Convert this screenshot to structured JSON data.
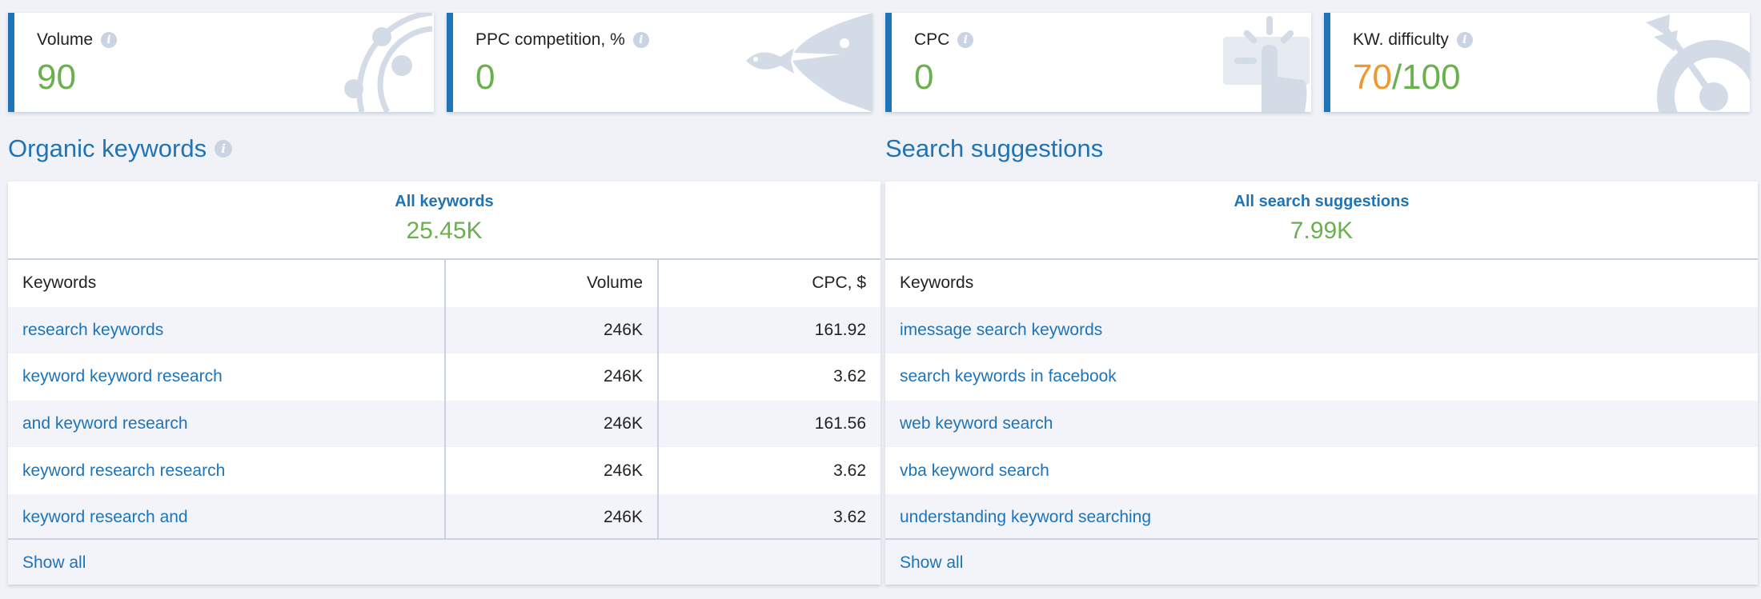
{
  "cards": [
    {
      "label": "Volume",
      "value": "90"
    },
    {
      "label": "PPC competition, %",
      "value": "0"
    },
    {
      "label": "CPC",
      "value": "0"
    },
    {
      "label": "KW. difficulty",
      "value_part1": "70",
      "value_part2": "/100"
    }
  ],
  "organic": {
    "title": "Organic keywords",
    "all_label": "All keywords",
    "total": "25.45K",
    "columns": [
      "Keywords",
      "Volume",
      "CPC, $"
    ],
    "rows": [
      {
        "keyword": "research keywords",
        "volume": "246K",
        "cpc": "161.92"
      },
      {
        "keyword": "keyword keyword research",
        "volume": "246K",
        "cpc": "3.62"
      },
      {
        "keyword": "and keyword research",
        "volume": "246K",
        "cpc": "161.56"
      },
      {
        "keyword": "keyword research research",
        "volume": "246K",
        "cpc": "3.62"
      },
      {
        "keyword": "keyword research and",
        "volume": "246K",
        "cpc": "3.62"
      }
    ],
    "show_all": "Show all"
  },
  "suggestions": {
    "title": "Search suggestions",
    "all_label": "All search suggestions",
    "total": "7.99K",
    "column": "Keywords",
    "rows": [
      "imessage search keywords",
      "search keywords in facebook",
      "web keyword search",
      "vba keyword search",
      "understanding keyword searching"
    ],
    "show_all": "Show all"
  },
  "colors": {
    "accent": "#1f73b7",
    "positive": "#6ab04c",
    "warning": "#f0982c"
  },
  "icons": [
    "info-icon",
    "orbit-illustration",
    "fish-illustration",
    "click-hand-illustration",
    "target-arrow-illustration"
  ]
}
